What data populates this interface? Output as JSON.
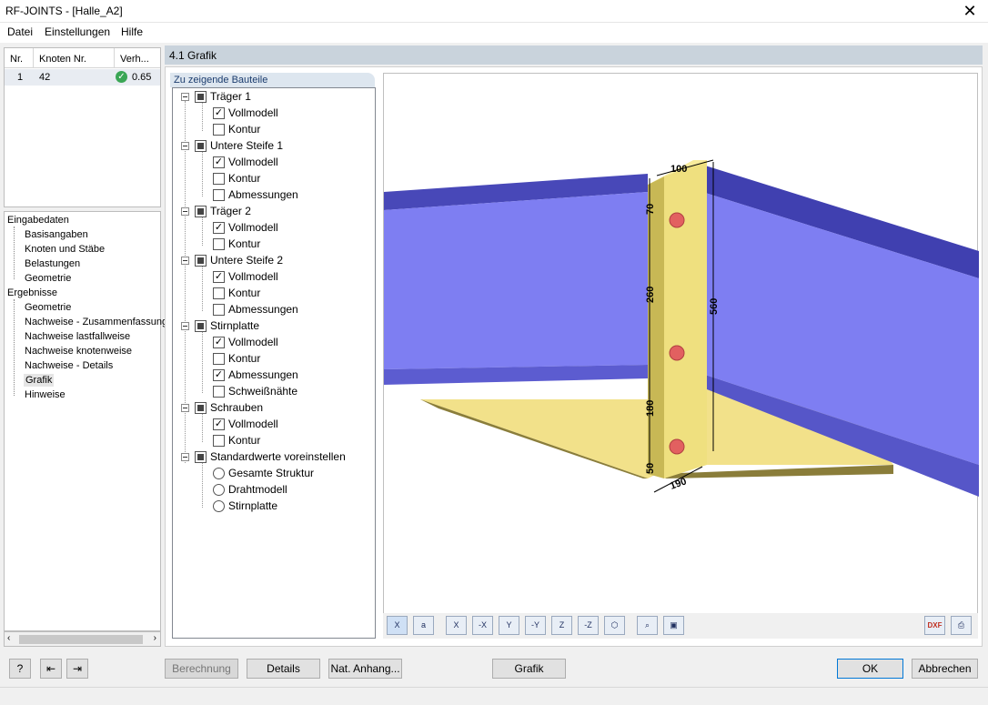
{
  "window": {
    "title": "RF-JOINTS - [Halle_A2]",
    "close": "✕"
  },
  "menu": [
    "Datei",
    "Einstellungen",
    "Hilfe"
  ],
  "table": {
    "headers": [
      "Nr.",
      "Knoten Nr.",
      "Verh..."
    ],
    "rows": [
      {
        "nr": "1",
        "knoten": "42",
        "verh": "0.65",
        "status_icon": "check-ok-icon"
      }
    ]
  },
  "nav": {
    "eingabedaten": "Eingabedaten",
    "eingabe_items": [
      "Basisangaben",
      "Knoten und Stäbe",
      "Belastungen",
      "Geometrie"
    ],
    "ergebnisse": "Ergebnisse",
    "ergebnis_items": [
      "Geometrie",
      "Nachweise - Zusammenfassung",
      "Nachweise lastfallweise",
      "Nachweise knotenweise",
      "Nachweise - Details",
      "Grafik",
      "Hinweise"
    ]
  },
  "section_title": "4.1 Grafik",
  "tree_tab": "Zu zeigende Bauteile",
  "tree": {
    "g1": {
      "label": "Träger 1",
      "items": [
        "Vollmodell",
        "Kontur"
      ],
      "checked": [
        true,
        false
      ]
    },
    "g2": {
      "label": "Untere Steife 1",
      "items": [
        "Vollmodell",
        "Kontur",
        "Abmessungen"
      ],
      "checked": [
        true,
        false,
        false
      ]
    },
    "g3": {
      "label": "Träger 2",
      "items": [
        "Vollmodell",
        "Kontur"
      ],
      "checked": [
        true,
        false
      ]
    },
    "g4": {
      "label": "Untere Steife 2",
      "items": [
        "Vollmodell",
        "Kontur",
        "Abmessungen"
      ],
      "checked": [
        true,
        false,
        false
      ]
    },
    "g5": {
      "label": "Stirnplatte",
      "items": [
        "Vollmodell",
        "Kontur",
        "Abmessungen",
        "Schweißnähte"
      ],
      "checked": [
        true,
        false,
        true,
        false
      ]
    },
    "g6": {
      "label": "Schrauben",
      "items": [
        "Vollmodell",
        "Kontur"
      ],
      "checked": [
        true,
        false
      ]
    },
    "g7": {
      "label": "Standardwerte voreinstellen",
      "items": [
        "Gesamte Struktur",
        "Drahtmodell",
        "Stirnplatte"
      ]
    }
  },
  "dimensions": {
    "d100": "100",
    "d70": "70",
    "d260": "260",
    "d560": "560",
    "d180": "180",
    "d50": "50",
    "d190": "190"
  },
  "view_toolbar": {
    "buttons": [
      "X",
      "a",
      "X",
      "-X",
      "Y",
      "-Y",
      "Z",
      "-Z",
      "",
      "",
      ""
    ],
    "dxf": "DXF"
  },
  "buttons": {
    "berechnung": "Berechnung",
    "details": "Details",
    "nat_anhang": "Nat. Anhang...",
    "grafik": "Grafik",
    "ok": "OK",
    "abbrechen": "Abbrechen"
  },
  "colors": {
    "beam": "#7b7bf0",
    "beam_top": "#4040b8",
    "plate": "#e8d570",
    "bolt": "#e06060",
    "header": "#c9d3dc"
  }
}
